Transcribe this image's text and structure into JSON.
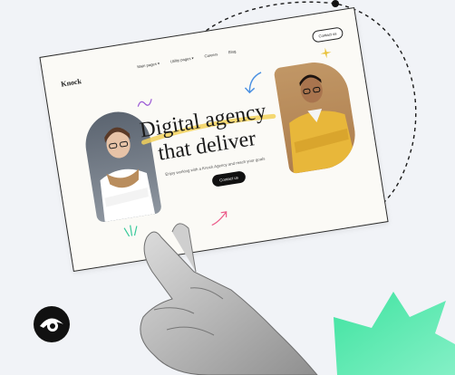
{
  "website": {
    "logo": "Knock",
    "nav": [
      "Main pages ▾",
      "Utility pages ▾",
      "Careers",
      "Blog"
    ],
    "contact_top": "Contact us",
    "headline_line1": "Digital agency",
    "headline_line2": "that deliver",
    "subtitle": "Enjoy working with a Knock Agency and reach your goals",
    "cta": "Contact us"
  },
  "icons": [
    "eye-icon"
  ],
  "colors": {
    "background": "#f1f3f7",
    "green_burst": "#4fe3a3",
    "card_bg": "#fbfaf6",
    "highlight": "#f2d15b",
    "button": "#111111"
  }
}
